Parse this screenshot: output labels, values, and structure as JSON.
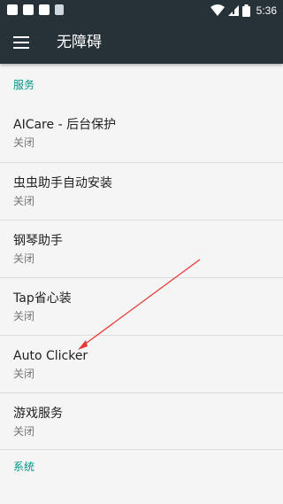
{
  "status_bar": {
    "time": "5:36",
    "icons": [
      "wifi-icon",
      "signal-icon",
      "battery-icon"
    ]
  },
  "app_bar": {
    "title": "无障碍",
    "menu_icon": "menu-icon"
  },
  "sections": [
    {
      "header": "服务"
    },
    {
      "header": "系统"
    }
  ],
  "services": [
    {
      "title": "AICare - 后台保护",
      "status": "关闭"
    },
    {
      "title": "虫虫助手自动安装",
      "status": "关闭"
    },
    {
      "title": "钢琴助手",
      "status": "关闭"
    },
    {
      "title": "Tap省心装",
      "status": "关闭"
    },
    {
      "title": "Auto Clicker",
      "status": "关闭"
    },
    {
      "title": "游戏服务",
      "status": "关闭"
    }
  ],
  "colors": {
    "bar": "#263238",
    "accent": "#009688",
    "background": "#f5f5f5",
    "arrow": "#e53935"
  }
}
